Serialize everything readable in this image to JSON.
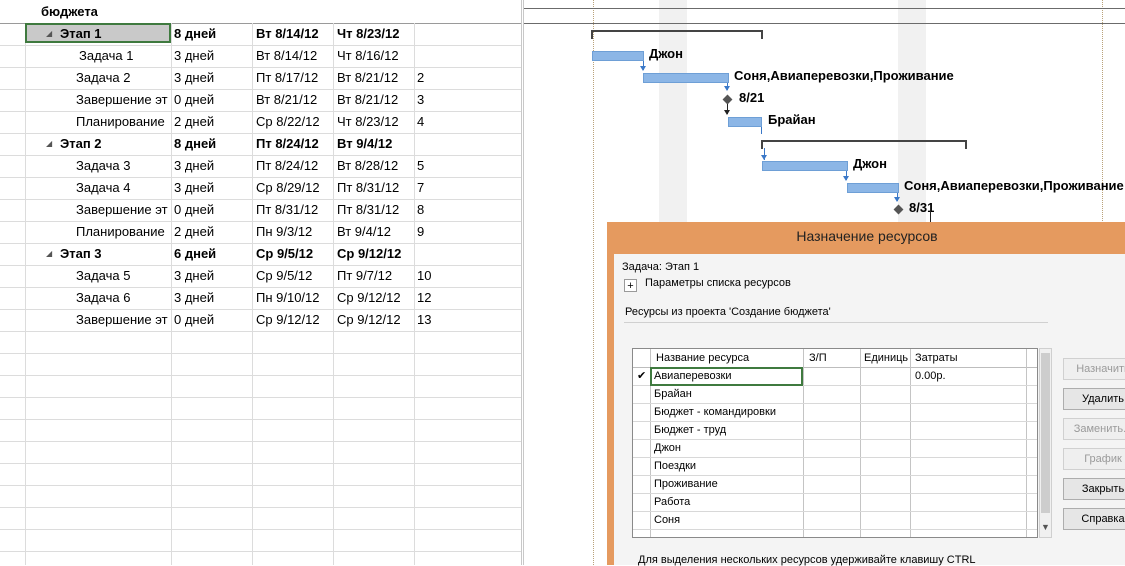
{
  "table": {
    "header_title": "бюджета",
    "rows": [
      {
        "name": "Этап 1",
        "duration": "8 дней",
        "start": "Вт 8/14/12",
        "finish": "Чт 8/23/12",
        "pred": "",
        "summary": true
      },
      {
        "name": "Задача 1",
        "duration": "3 дней",
        "start": "Вт 8/14/12",
        "finish": "Чт 8/16/12",
        "pred": "",
        "summary": false
      },
      {
        "name": "Задача 2",
        "duration": "3 дней",
        "start": "Пт 8/17/12",
        "finish": "Вт 8/21/12",
        "pred": "2",
        "summary": false
      },
      {
        "name": "Завершение эт",
        "duration": "0 дней",
        "start": "Вт 8/21/12",
        "finish": "Вт 8/21/12",
        "pred": "3",
        "summary": false
      },
      {
        "name": "Планирование",
        "duration": "2 дней",
        "start": "Ср 8/22/12",
        "finish": "Чт 8/23/12",
        "pred": "4",
        "summary": false
      },
      {
        "name": "Этап 2",
        "duration": "8 дней",
        "start": "Пт 8/24/12",
        "finish": "Вт 9/4/12",
        "pred": "",
        "summary": true
      },
      {
        "name": "Задача 3",
        "duration": "3 дней",
        "start": "Пт 8/24/12",
        "finish": "Вт 8/28/12",
        "pred": "5",
        "summary": false
      },
      {
        "name": "Задача 4",
        "duration": "3 дней",
        "start": "Ср 8/29/12",
        "finish": "Пт 8/31/12",
        "pred": "7",
        "summary": false
      },
      {
        "name": "Завершение эт",
        "duration": "0 дней",
        "start": "Пт 8/31/12",
        "finish": "Пт 8/31/12",
        "pred": "8",
        "summary": false
      },
      {
        "name": "Планирование",
        "duration": "2 дней",
        "start": "Пн 9/3/12",
        "finish": "Вт 9/4/12",
        "pred": "9",
        "summary": false
      },
      {
        "name": "Этап 3",
        "duration": "6 дней",
        "start": "Ср 9/5/12",
        "finish": "Ср 9/12/12",
        "pred": "",
        "summary": true
      },
      {
        "name": "Задача 5",
        "duration": "3 дней",
        "start": "Ср 9/5/12",
        "finish": "Пт 9/7/12",
        "pred": "10",
        "summary": false
      },
      {
        "name": "Задача 6",
        "duration": "3 дней",
        "start": "Пн 9/10/12",
        "finish": "Ср 9/12/12",
        "pred": "12",
        "summary": false
      },
      {
        "name": "Завершение эт",
        "duration": "0 дней",
        "start": "Ср 9/12/12",
        "finish": "Ср 9/12/12",
        "pred": "13",
        "summary": false
      }
    ]
  },
  "gantt": {
    "labels": {
      "task1": "Джон",
      "task2": "Соня,Авиаперевозки,Проживание",
      "milestone1": "8/21",
      "plan1": "Брайан",
      "task3": "Джон",
      "task4": "Соня,Авиаперевозки,Проживание",
      "milestone2": "8/31"
    }
  },
  "dialog": {
    "title": "Назначение ресурсов",
    "task_label": "Задача:  Этап 1",
    "options_label": "Параметры списка ресурсов",
    "project_label": "Ресурсы из проекта 'Создание бюджета'",
    "columns": [
      "Название ресурса",
      "З/П",
      "Единицы",
      "Затраты"
    ],
    "resources": [
      {
        "name": "Авиаперевозки",
        "cost": "0.00р.",
        "checked": true
      },
      {
        "name": "Брайан",
        "cost": "",
        "checked": false
      },
      {
        "name": "Бюджет - командировки",
        "cost": "",
        "checked": false
      },
      {
        "name": "Бюджет - труд",
        "cost": "",
        "checked": false
      },
      {
        "name": "Джон",
        "cost": "",
        "checked": false
      },
      {
        "name": "Поездки",
        "cost": "",
        "checked": false
      },
      {
        "name": "Проживание",
        "cost": "",
        "checked": false
      },
      {
        "name": "Работа",
        "cost": "",
        "checked": false
      },
      {
        "name": "Соня",
        "cost": "",
        "checked": false
      }
    ],
    "buttons": {
      "assign": "Назначить",
      "remove": "Удалить",
      "replace": "Заменить...",
      "graph": "График",
      "close": "Закрыть",
      "help": "Справка"
    },
    "hint": "Для выделения нескольких ресурсов удерживайте клавишу CTRL"
  }
}
